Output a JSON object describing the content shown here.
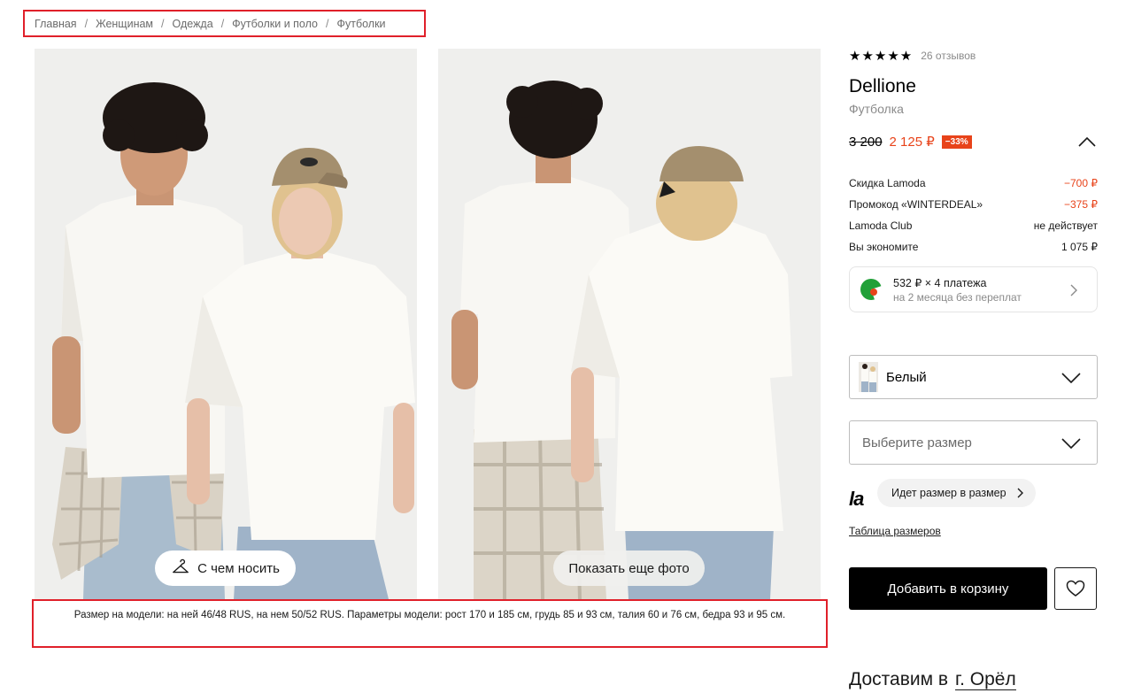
{
  "breadcrumb": {
    "items": [
      "Главная",
      "Женщинам",
      "Одежда",
      "Футболки и поло",
      "Футболки"
    ],
    "separator": "/"
  },
  "gallery": {
    "wear_button_label": "С чем носить",
    "more_photos_label": "Показать еще фото",
    "model_note": "Размер на модели: на ней 46/48 RUS, на нем 50/52 RUS. Параметры модели: рост 170 и 185 см, грудь 85 и 93 см, талия 60 и 76 см, бедра 93 и 95 см."
  },
  "product": {
    "stars": "★★★★★",
    "rating": 5,
    "reviews": "26 отзывов",
    "brand": "Dellione",
    "type": "Футболка",
    "old_price": "3 200",
    "new_price": "2 125 ₽",
    "discount": "−33%"
  },
  "price_breakdown": [
    {
      "label": "Скидка Lamoda",
      "value": "−700 ₽",
      "accent": true
    },
    {
      "label": "Промокод «WINTERDEAL»",
      "value": "−375 ₽",
      "accent": true
    },
    {
      "label": "Lamoda Club",
      "value": "не действует",
      "accent": false
    },
    {
      "label": "Вы экономите",
      "value": "1 075 ₽",
      "accent": false
    }
  ],
  "installment": {
    "line1": "532 ₽ × 4 платежа",
    "line2": "на 2 месяца без переплат"
  },
  "color_select": {
    "value": "Белый"
  },
  "size_select": {
    "placeholder": "Выберите размер"
  },
  "fit": {
    "logo": "la",
    "bubble": "Идет размер в размер"
  },
  "size_table_link": "Таблица размеров",
  "add_to_cart": "Добавить в корзину",
  "delivery": {
    "prefix": "Доставим в",
    "city": "г. Орёл"
  },
  "colors": {
    "accent": "#e8431a",
    "highlight_border": "#e0202a",
    "button_bg": "#000000"
  }
}
